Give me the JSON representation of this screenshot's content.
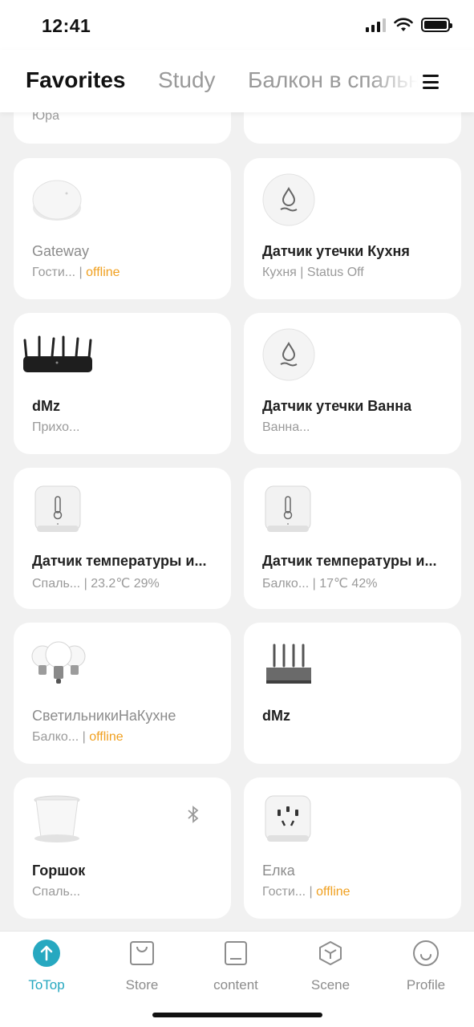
{
  "status": {
    "time": "12:41"
  },
  "tabs": [
    "Favorites",
    "Study",
    "Балкон в спальне"
  ],
  "cards": {
    "top_left": {
      "sub": "Юра"
    },
    "gateway": {
      "name": "Gateway",
      "room": "Гости...",
      "sep": "|",
      "state": "offline"
    },
    "leak_kitchen": {
      "name": "Датчик утечки Кухня",
      "room": "Кухня",
      "sep": "|",
      "state": "Status Off"
    },
    "dmz_router": {
      "name": "dMz",
      "room": "Прихо..."
    },
    "leak_bath": {
      "name": "Датчик утечки Ванна",
      "room": "Ванна..."
    },
    "temp_bedroom": {
      "name": "Датчик температуры и...",
      "room": "Спаль...",
      "sep": "|",
      "state": "23.2℃ 29%"
    },
    "temp_balcony": {
      "name": "Датчик температуры и...",
      "room": "Балко...",
      "sep": "|",
      "state": "17℃ 42%"
    },
    "lights": {
      "name": "СветильникиНаКухне",
      "room": "Балко...",
      "sep": "|",
      "state": "offline"
    },
    "dmz_2": {
      "name": "dMz"
    },
    "pot": {
      "name": "Горшок",
      "room": "Спаль..."
    },
    "elka": {
      "name": "Елка",
      "room": "Гости...",
      "sep": "|",
      "state": "offline"
    }
  },
  "nav": {
    "totop": "ToTop",
    "store": "Store",
    "content": "content",
    "scene": "Scene",
    "profile": "Profile"
  },
  "colors": {
    "accent": "#27a8c0",
    "offline": "#f0a020"
  }
}
